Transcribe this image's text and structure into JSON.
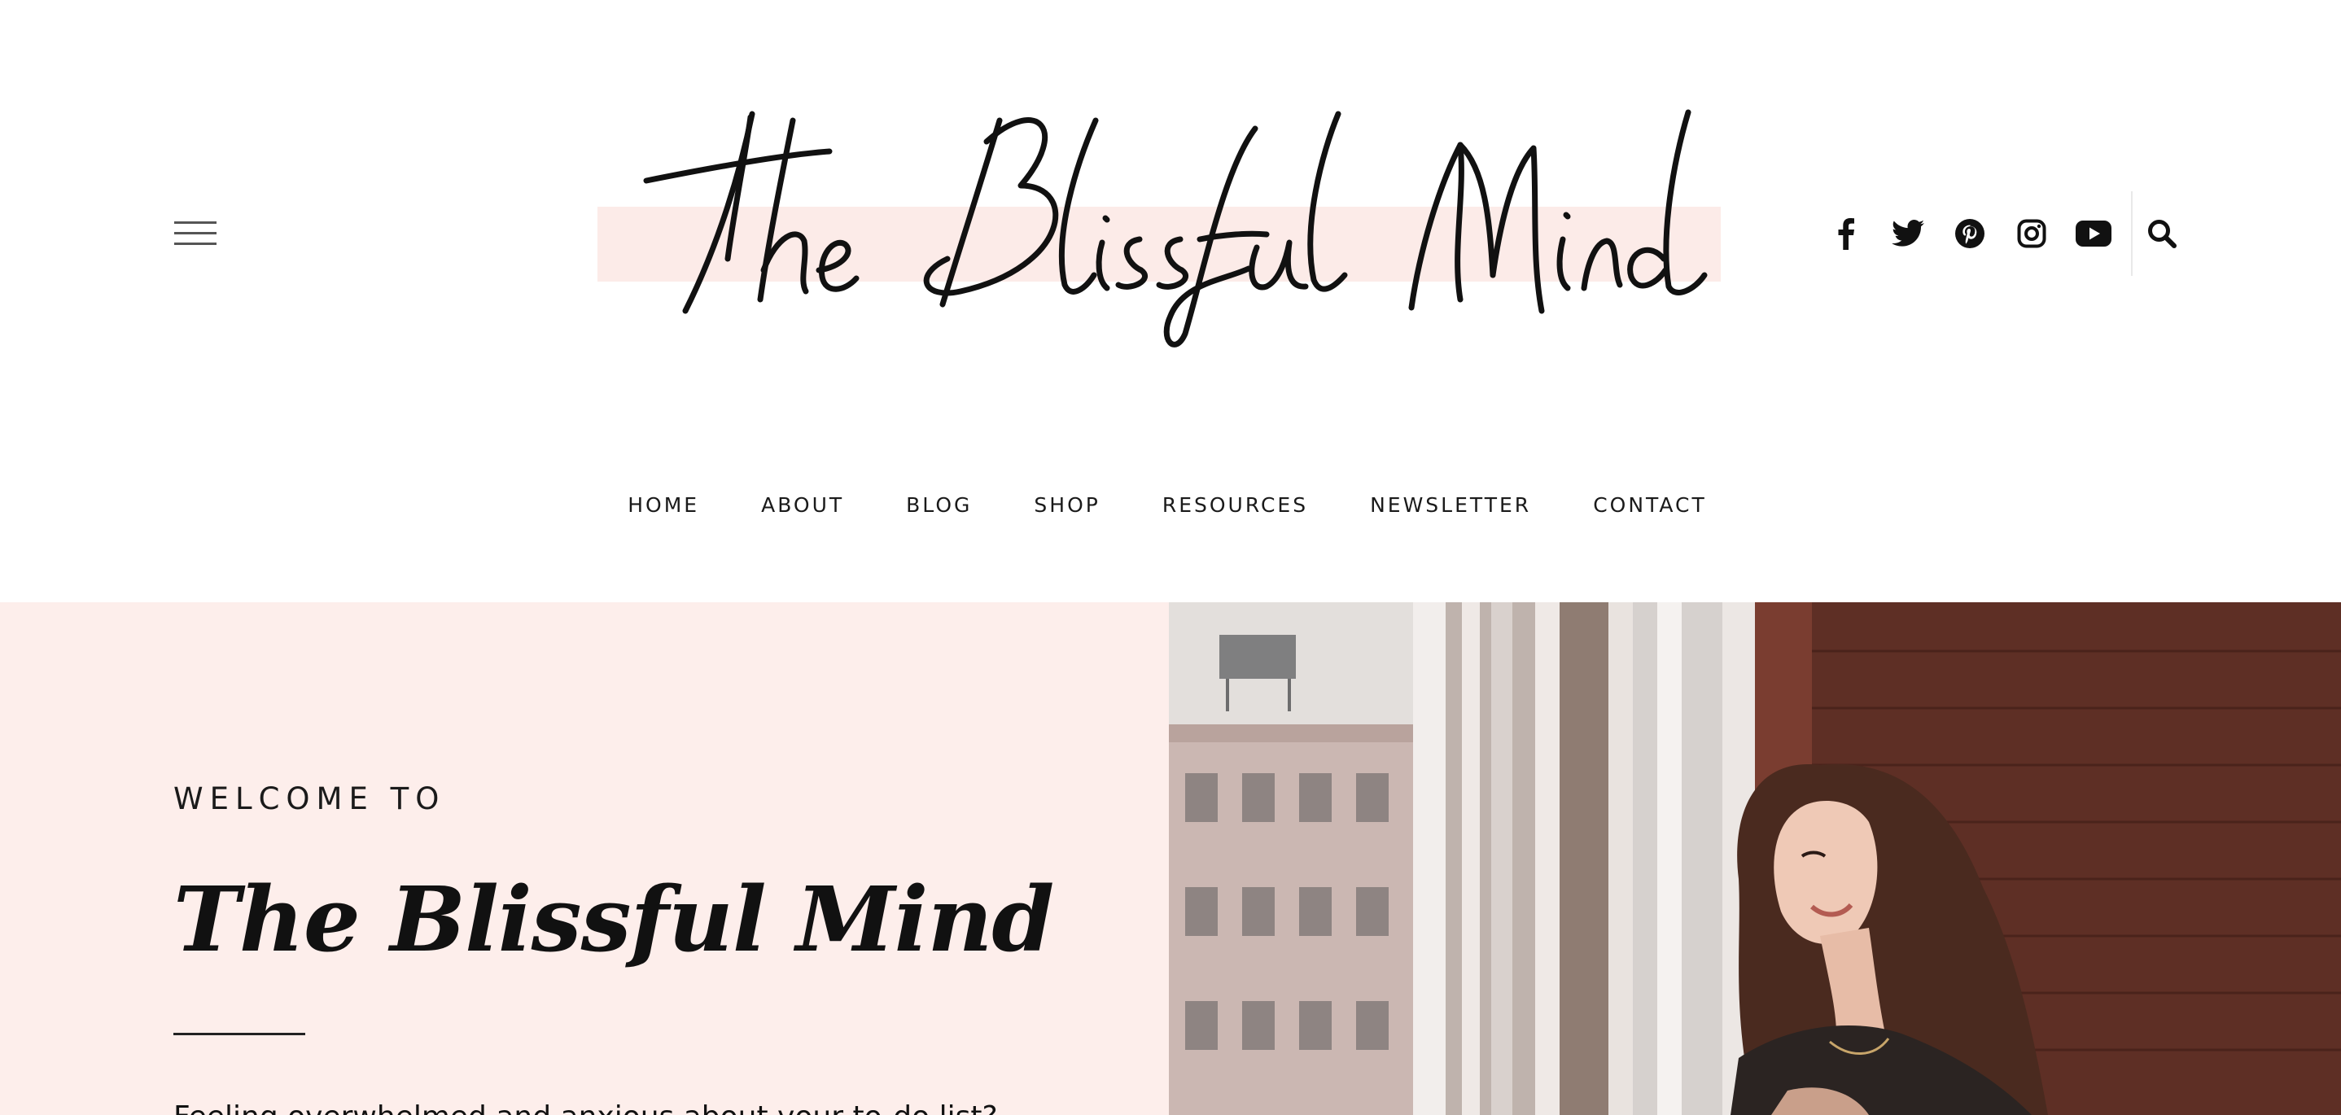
{
  "header": {
    "menu_icon": "hamburger-menu-icon",
    "logo_text": "The Blissful Mind",
    "social_icons": [
      "facebook-icon",
      "twitter-icon",
      "pinterest-icon",
      "instagram-icon",
      "youtube-icon"
    ],
    "search_icon": "search-icon"
  },
  "nav": {
    "items": [
      {
        "label": "HOME"
      },
      {
        "label": "ABOUT"
      },
      {
        "label": "BLOG"
      },
      {
        "label": "SHOP"
      },
      {
        "label": "RESOURCES"
      },
      {
        "label": "NEWSLETTER"
      },
      {
        "label": "CONTACT"
      }
    ]
  },
  "hero": {
    "eyebrow": "WELCOME TO",
    "title": "The Blissful Mind",
    "intro": "Feeling overwhelmed and anxious about your to-do list?"
  },
  "colors": {
    "accent_pink": "#fcebe8",
    "hero_bg": "#fdeeeb",
    "text": "#111111"
  }
}
